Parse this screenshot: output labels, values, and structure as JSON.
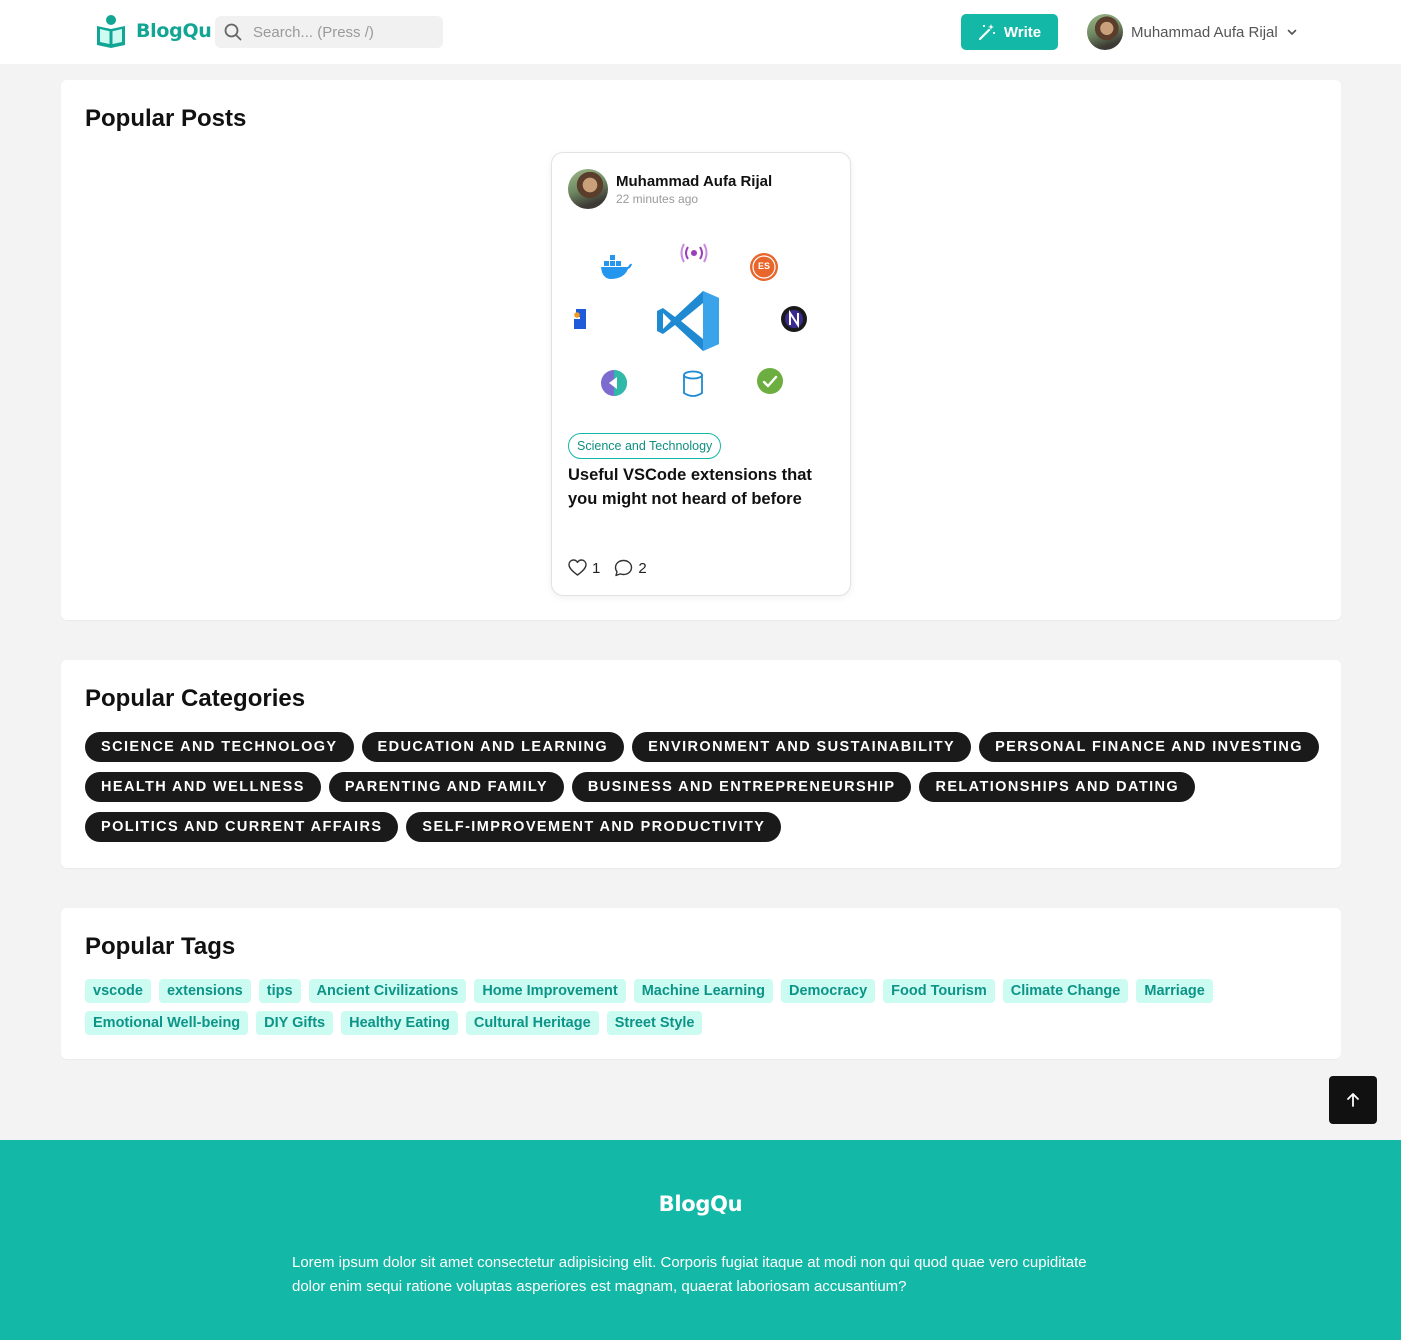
{
  "header": {
    "brand": "BlogQu",
    "search_placeholder": "Search... (Press /)",
    "write_label": "Write",
    "user_name": "Muhammad Aufa Rijal"
  },
  "popular_posts": {
    "title": "Popular Posts",
    "posts": [
      {
        "author": "Muhammad Aufa Rijal",
        "time": "22 minutes ago",
        "category": "Science and Technology",
        "title": "Useful VSCode extensions that you might not heard of before",
        "likes": "1",
        "comments": "2"
      }
    ]
  },
  "popular_categories": {
    "title": "Popular Categories",
    "items": [
      "Science and Technology",
      "Education and Learning",
      "Environment and Sustainability",
      "Personal Finance and Investing",
      "Health and Wellness",
      "Parenting and Family",
      "Business and Entrepreneurship",
      "Relationships and Dating",
      "Politics and Current Affairs",
      "Self-Improvement and Productivity"
    ]
  },
  "popular_tags": {
    "title": "Popular Tags",
    "items": [
      "vscode",
      "extensions",
      "tips",
      "Ancient Civilizations",
      "Home Improvement",
      "Machine Learning",
      "Democracy",
      "Food Tourism",
      "Climate Change",
      "Marriage",
      "Emotional Well-being",
      "DIY Gifts",
      "Healthy Eating",
      "Cultural Heritage",
      "Street Style"
    ]
  },
  "footer": {
    "brand": "BlogQu",
    "text": "Lorem ipsum dolor sit amet consectetur adipisicing elit. Corporis fugiat itaque at modi non qui quod quae vero cupiditate dolor enim sequi ratione voluptas asperiores est magnam, quaerat laboriosam accusantium?"
  },
  "icons": {
    "brand": "book-reader-icon",
    "search": "search-icon",
    "write": "magic-wand-icon",
    "dropdown": "chevron-down-icon",
    "like": "heart-icon",
    "comment": "comment-icon",
    "back_to_top": "arrow-up-icon"
  },
  "colors": {
    "accent": "#14b8a6",
    "tag_bg": "#ccfbf1",
    "tag_text": "#0d9488",
    "pill_dark": "#1a1a1a",
    "page_bg": "#f3f3f3"
  }
}
